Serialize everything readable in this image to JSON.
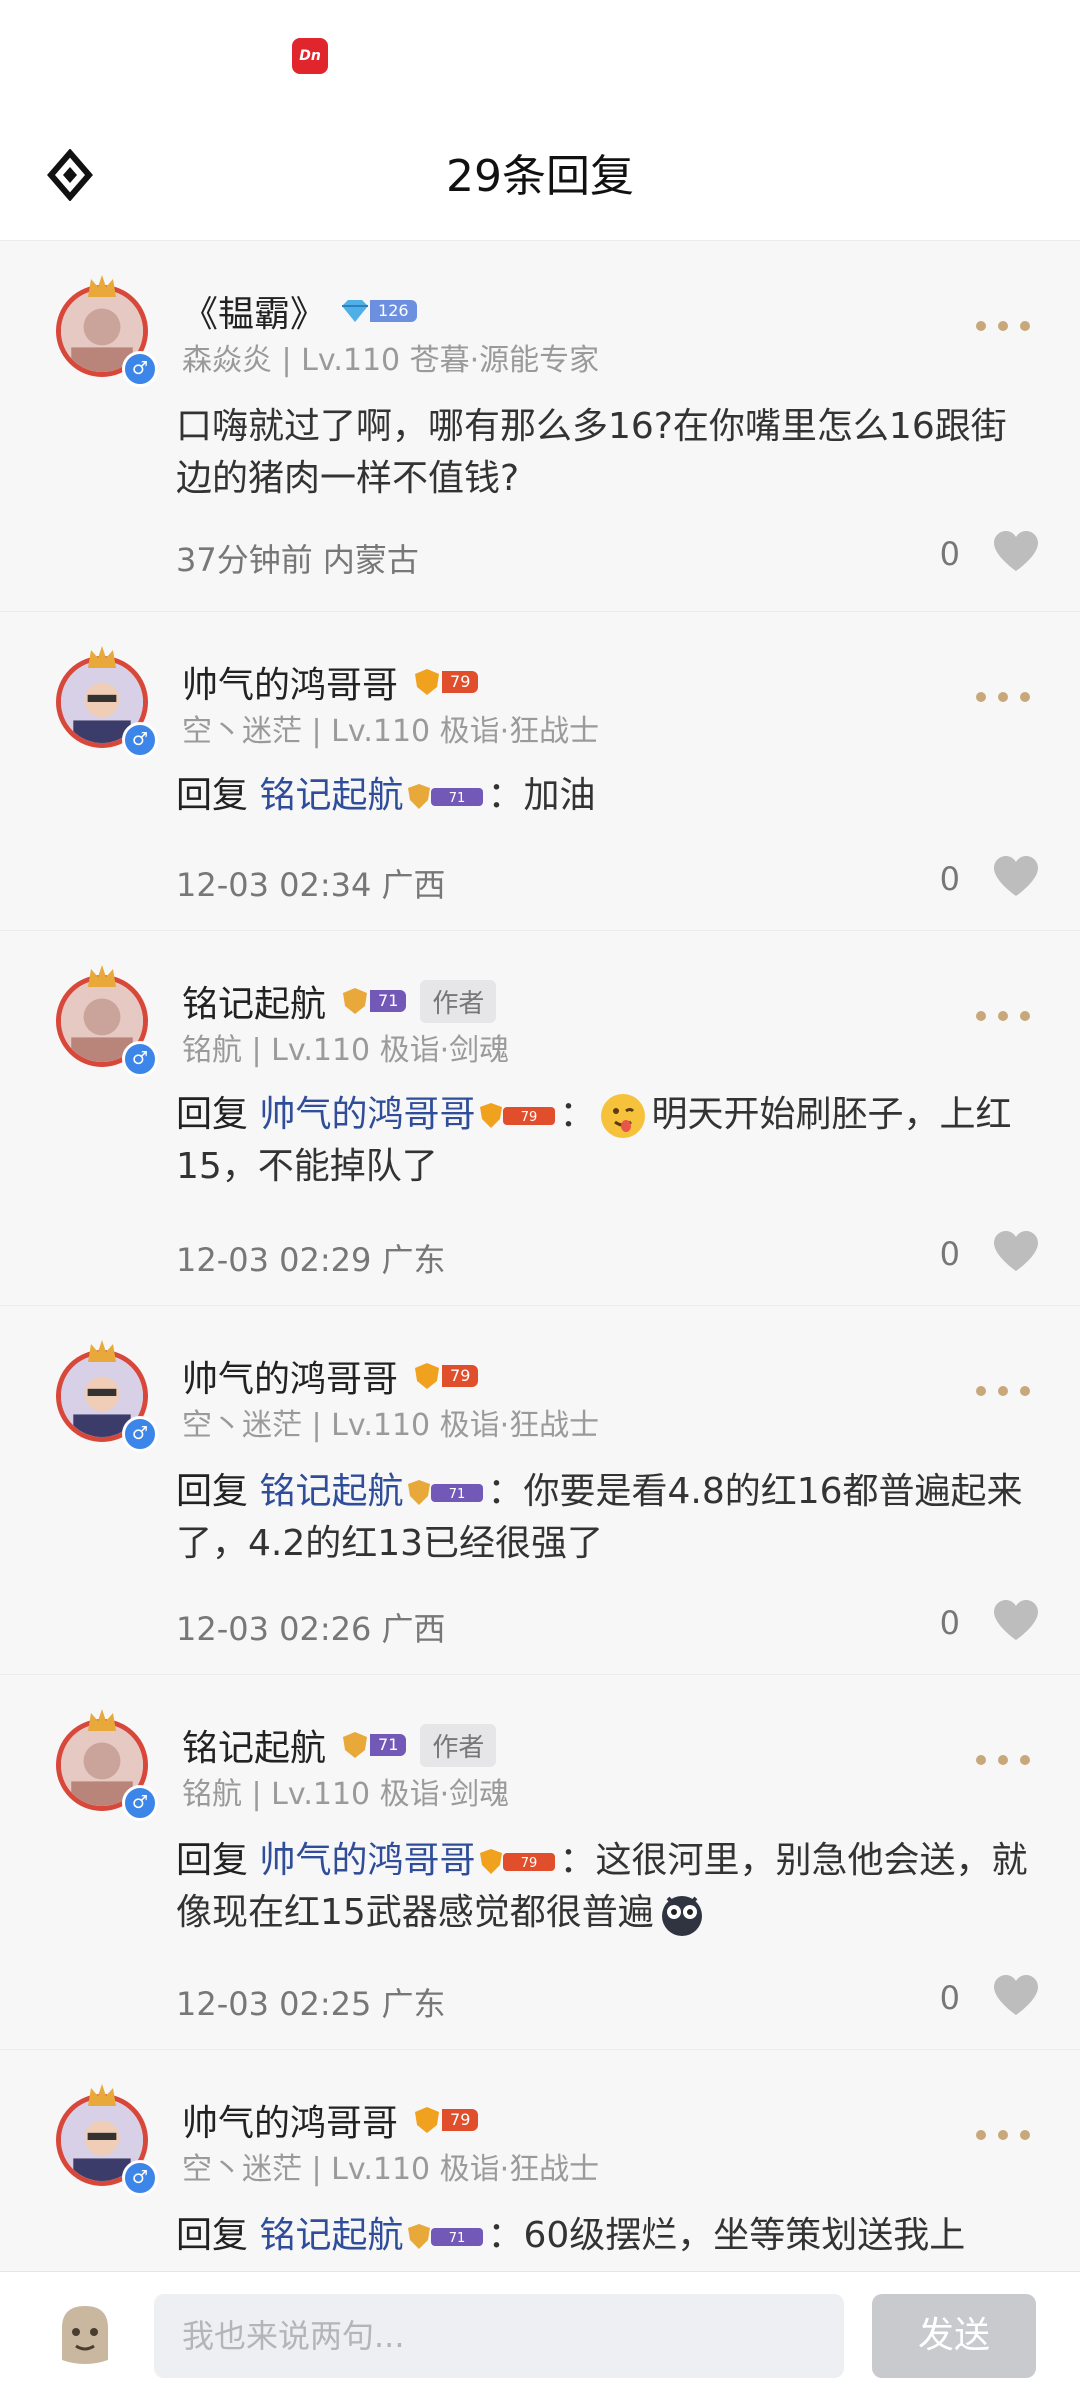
{
  "header": {
    "title": "29条回复",
    "app_badge_text": "Dn"
  },
  "comments": [
    {
      "username": "《韫霸》",
      "badge": {
        "type": "blue",
        "level": "126"
      },
      "author_tag": "",
      "meta": "森焱炎 | Lv.110 苍暮·源能专家",
      "reply_prefix": "",
      "mention": "",
      "mention_badge": "",
      "text": "口嗨就过了啊，哪有那么多16?在你嘴里怎么16跟街边的猪肉一样不值钱?",
      "time_loc": "37分钟前 内蒙古",
      "likes": "0"
    },
    {
      "username": "帅气的鸿哥哥",
      "badge": {
        "type": "red",
        "level": "79"
      },
      "author_tag": "",
      "meta": "空丶迷茫 | Lv.110 极诣·狂战士",
      "reply_prefix": "回复 ",
      "mention": "铭记起航",
      "mention_badge": "71",
      "text": "：加油",
      "time_loc": "12-03 02:34 广西",
      "likes": "0"
    },
    {
      "username": "铭记起航",
      "badge": {
        "type": "purple",
        "level": "71"
      },
      "author_tag": "作者",
      "meta": "铭航 | Lv.110 极诣·剑魂",
      "reply_prefix": "回复 ",
      "mention": "帅气的鸿哥哥",
      "mention_badge": "79",
      "text": "明天开始刷胚子，上红15，不能掉队了",
      "time_loc": "12-03 02:29 广东",
      "likes": "0"
    },
    {
      "username": "帅气的鸿哥哥",
      "badge": {
        "type": "red",
        "level": "79"
      },
      "author_tag": "",
      "meta": "空丶迷茫 | Lv.110 极诣·狂战士",
      "reply_prefix": "回复 ",
      "mention": "铭记起航",
      "mention_badge": "71",
      "text": "：你要是看4.8的红16都普遍起来了，4.2的红13已经很强了",
      "time_loc": "12-03 02:26 广西",
      "likes": "0"
    },
    {
      "username": "铭记起航",
      "badge": {
        "type": "purple",
        "level": "71"
      },
      "author_tag": "作者",
      "meta": "铭航 | Lv.110 极诣·剑魂",
      "reply_prefix": "回复 ",
      "mention": "帅气的鸿哥哥",
      "mention_badge": "79",
      "text": "：这很河里，别急他会送，就像现在红15武器感觉都很普遍",
      "time_loc": "12-03 02:25 广东",
      "likes": "0"
    },
    {
      "username": "帅气的鸿哥哥",
      "badge": {
        "type": "red",
        "level": "79"
      },
      "author_tag": "",
      "meta": "空丶迷茫 | Lv.110 极诣·狂战士",
      "reply_prefix": "回复 ",
      "mention": "铭记起航",
      "mention_badge": "71",
      "text": "：60级摆烂，坐等策划送我上",
      "time_loc": "",
      "likes": ""
    }
  ],
  "composer": {
    "placeholder": "我也来说两句...",
    "send_label": "发送"
  },
  "colors": {
    "mention": "#2f4d99",
    "accent_dots": "#c8a87a",
    "gender_blue": "#3b86e8",
    "send_disabled": "#c9cacd"
  }
}
